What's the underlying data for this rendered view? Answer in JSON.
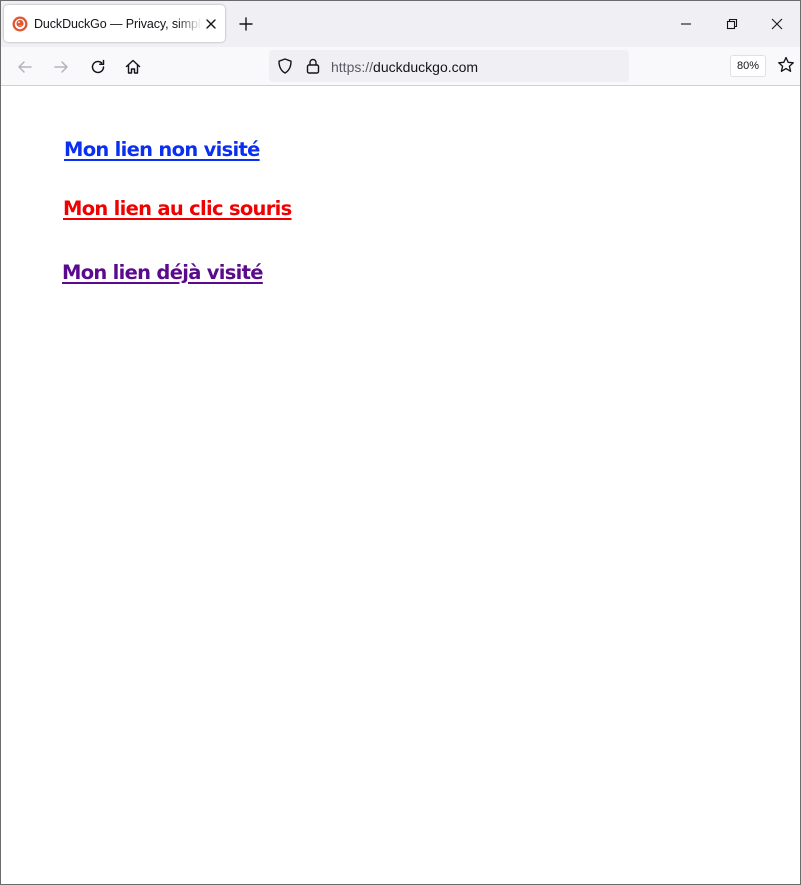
{
  "browser": {
    "tab": {
      "title": "DuckDuckGo — Privacy, simplified.",
      "favicon": "duckduckgo-logo",
      "close_icon": "close-icon"
    },
    "new_tab_icon": "plus-icon",
    "window_controls": [
      "minimize-icon",
      "restore-icon",
      "close-icon"
    ],
    "toolbar": {
      "back_icon": "arrow-left-icon",
      "forward_icon": "arrow-right-icon",
      "reload_icon": "reload-icon",
      "home_icon": "home-icon"
    },
    "urlbar": {
      "scheme": "https://",
      "host": "duckduckgo.com",
      "shield_icon": "tracking-protection-shield-icon",
      "lock_icon": "lock-icon",
      "zoom": "80%",
      "bookmark_icon": "star-icon"
    }
  },
  "page": {
    "links": [
      {
        "label": "Mon lien non visité",
        "state": "unvisited",
        "color": "#0a2ff0"
      },
      {
        "label": "Mon lien au clic souris",
        "state": "active",
        "color": "#f00000"
      },
      {
        "label": "Mon lien déjà visité",
        "state": "visited",
        "color": "#5a0a8c"
      }
    ]
  },
  "colors": {
    "tabstrip_bg": "#f0f0f4",
    "toolbar_bg": "#f9f9fb",
    "urlbar_bg": "#f0f0f4",
    "icon_color": "#5b5b66"
  }
}
